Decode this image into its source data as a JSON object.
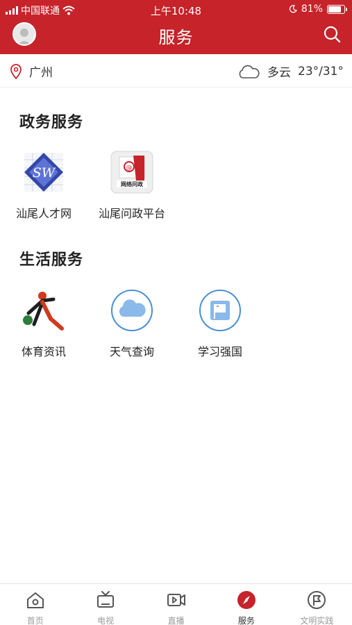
{
  "status_bar": {
    "carrier": "中国联通",
    "time": "上午10:48",
    "battery": "81%",
    "battery_level": 0.81
  },
  "header": {
    "title": "服务"
  },
  "location": {
    "city": "广州",
    "weather_desc": "多云",
    "temperature": "23°/31°"
  },
  "sections": [
    {
      "title": "政务服务",
      "items": [
        {
          "label": "汕尾人才网",
          "icon": "sw-logo-icon",
          "icon_text": "SW"
        },
        {
          "label": "汕尾问政平台",
          "icon": "wenzheng-logo-icon",
          "icon_text": "网络问政"
        }
      ]
    },
    {
      "title": "生活服务",
      "items": [
        {
          "label": "体育资讯",
          "icon": "sports-logo-icon"
        },
        {
          "label": "天气查询",
          "icon": "cloud-icon"
        },
        {
          "label": "学习强国",
          "icon": "flag-icon"
        }
      ]
    }
  ],
  "tabbar": {
    "items": [
      {
        "label": "首页",
        "icon": "home-icon",
        "active": false
      },
      {
        "label": "电视",
        "icon": "tv-icon",
        "active": false
      },
      {
        "label": "直播",
        "icon": "live-video-icon",
        "active": false
      },
      {
        "label": "服务",
        "icon": "compass-icon",
        "active": true
      },
      {
        "label": "文明实践",
        "icon": "banner-icon",
        "active": false
      }
    ]
  },
  "colors": {
    "brand_red": "#c6232a",
    "icon_blue": "#4a8fd4",
    "inactive_gray": "#999999"
  }
}
